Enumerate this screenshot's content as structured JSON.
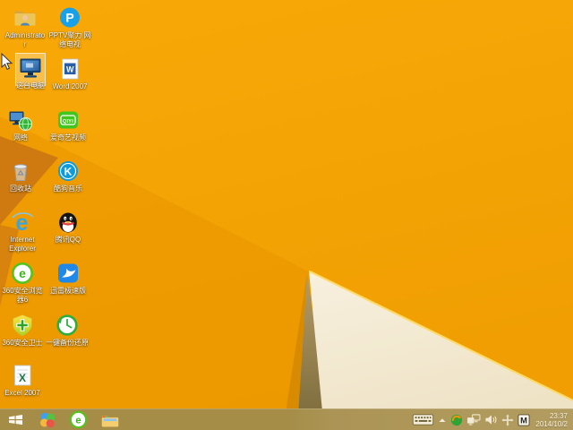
{
  "wallpaper": {
    "base_top": "#f8a907",
    "base_bottom": "#f09e02",
    "lower_left_facet": "#ea9600",
    "dark_wedge": "#cf7a10",
    "dark_strip": "#d8830d",
    "olive_triangle_top": "#b59c66",
    "olive_triangle_bottom": "#79683a",
    "cream_triangle_top": "#f7f0de",
    "cream_triangle_bottom": "#efe3c6",
    "edge_highlight": "#ffd95e"
  },
  "desktop": {
    "selected_icon": "这台电脑",
    "icons": [
      {
        "name": "administrator",
        "label": "Administrato\nr",
        "selected": false
      },
      {
        "name": "pptv",
        "label": "PPTV聚力 网\n络电视",
        "selected": false
      },
      {
        "name": "this-pc",
        "label": "这台电脑",
        "selected": true
      },
      {
        "name": "word-2007",
        "label": "Word 2007",
        "selected": false
      },
      {
        "name": "network",
        "label": "网络",
        "selected": false
      },
      {
        "name": "iqiyi-video",
        "label": "爱奇艺视频",
        "selected": false
      },
      {
        "name": "recycle-bin",
        "label": "回收站",
        "selected": false
      },
      {
        "name": "kugou-music",
        "label": "酷狗音乐",
        "selected": false
      },
      {
        "name": "internet-explorer",
        "label": "Internet\nExplorer",
        "selected": false
      },
      {
        "name": "tencent-qq",
        "label": "腾讯QQ",
        "selected": false
      },
      {
        "name": "360-browser-6",
        "label": "360安全浏览\n器6",
        "selected": false
      },
      {
        "name": "xunlei-speed",
        "label": "迅雷极速版",
        "selected": false
      },
      {
        "name": "360-safe-guard",
        "label": "360安全卫士",
        "selected": false
      },
      {
        "name": "one-key-backup",
        "label": "一键备份还原",
        "selected": false
      },
      {
        "name": "excel-2007",
        "label": "Excel 2007",
        "selected": false
      }
    ]
  },
  "taskbar": {
    "buttons": [
      {
        "name": "start"
      },
      {
        "name": "software-manager"
      },
      {
        "name": "360-browser"
      },
      {
        "name": "file-explorer"
      }
    ],
    "tray_icons": [
      {
        "name": "touch-keyboard"
      },
      {
        "name": "show-hidden-icons"
      },
      {
        "name": "360-security-tray"
      },
      {
        "name": "network-status"
      },
      {
        "name": "volume"
      },
      {
        "name": "input-tools"
      },
      {
        "name": "input-mode-m"
      }
    ],
    "clock": {
      "time": "23:37",
      "date": "2014/10/2"
    }
  }
}
